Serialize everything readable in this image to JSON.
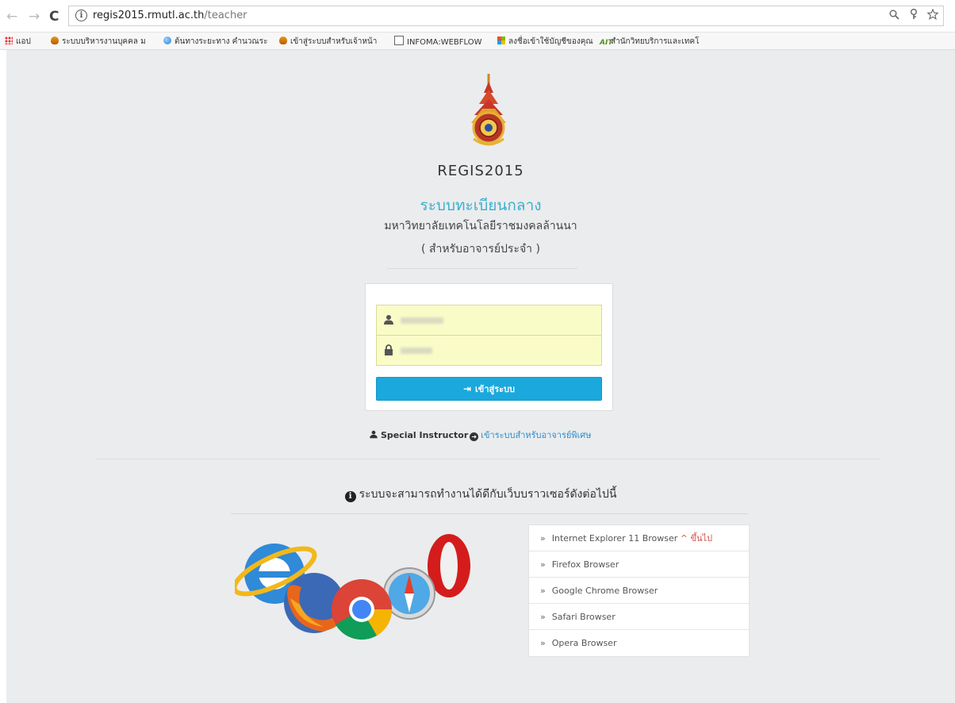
{
  "browser": {
    "url_host": "regis2015.rmutl.ac.th",
    "url_path": "/teacher",
    "nav_back": "←",
    "nav_forward": "→",
    "nav_reload": "C",
    "omni_icons": [
      "zoom-icon",
      "key-icon",
      "star-icon"
    ],
    "bookmarks": [
      {
        "icon": "apps-icon",
        "label": "แอป"
      },
      {
        "icon": "flame-icon",
        "label": "ระบบบริหารงานบุคคล ม"
      },
      {
        "icon": "globe-icon",
        "label": "ต้นทางระยะทาง คำนวณระ"
      },
      {
        "icon": "flame-icon",
        "label": "เข้าสู่ระบบสำหรับเจ้าหน้า"
      },
      {
        "icon": "document-icon",
        "label": "INFOMA:WEBFLOW"
      },
      {
        "icon": "microsoft-icon",
        "label": "ลงชื่อเข้าใช้บัญชีของคุณ"
      },
      {
        "icon": "ait-icon",
        "label": "สำนักวิทยบริการและเทคโ"
      }
    ]
  },
  "header": {
    "app_title": "REGIS2015",
    "system_title": "ระบบทะเบียนกลาง",
    "university": "มหาวิทยาลัยเทคโนโลยีราชมงคลล้านนา",
    "audience": "( สำหรับอาจารย์ประจำ )"
  },
  "login": {
    "username_value": "",
    "password_value": "",
    "submit_label": "เข้าสู่ระบบ"
  },
  "special": {
    "label": "Special Instructor",
    "link": "เข้าระบบสำหรับอาจารย์พิเศษ"
  },
  "compat": {
    "heading": "ระบบจะสามารถทำงานได้ดีกับเว็บบราวเซอร์ดังต่อไปนี้",
    "browsers": [
      {
        "name": "Internet Explorer 11 Browser",
        "note": "^ ขึ้นไป"
      },
      {
        "name": "Firefox Browser",
        "note": ""
      },
      {
        "name": "Google Chrome Browser",
        "note": ""
      },
      {
        "name": "Safari Browser",
        "note": ""
      },
      {
        "name": "Opera Browser",
        "note": ""
      }
    ]
  },
  "colors": {
    "accent": "#1ba8dc",
    "title_blue": "#3ab0cf",
    "field_yellow": "#fafcc8",
    "page_bg": "#ebeced",
    "note_red": "#d9534f"
  }
}
